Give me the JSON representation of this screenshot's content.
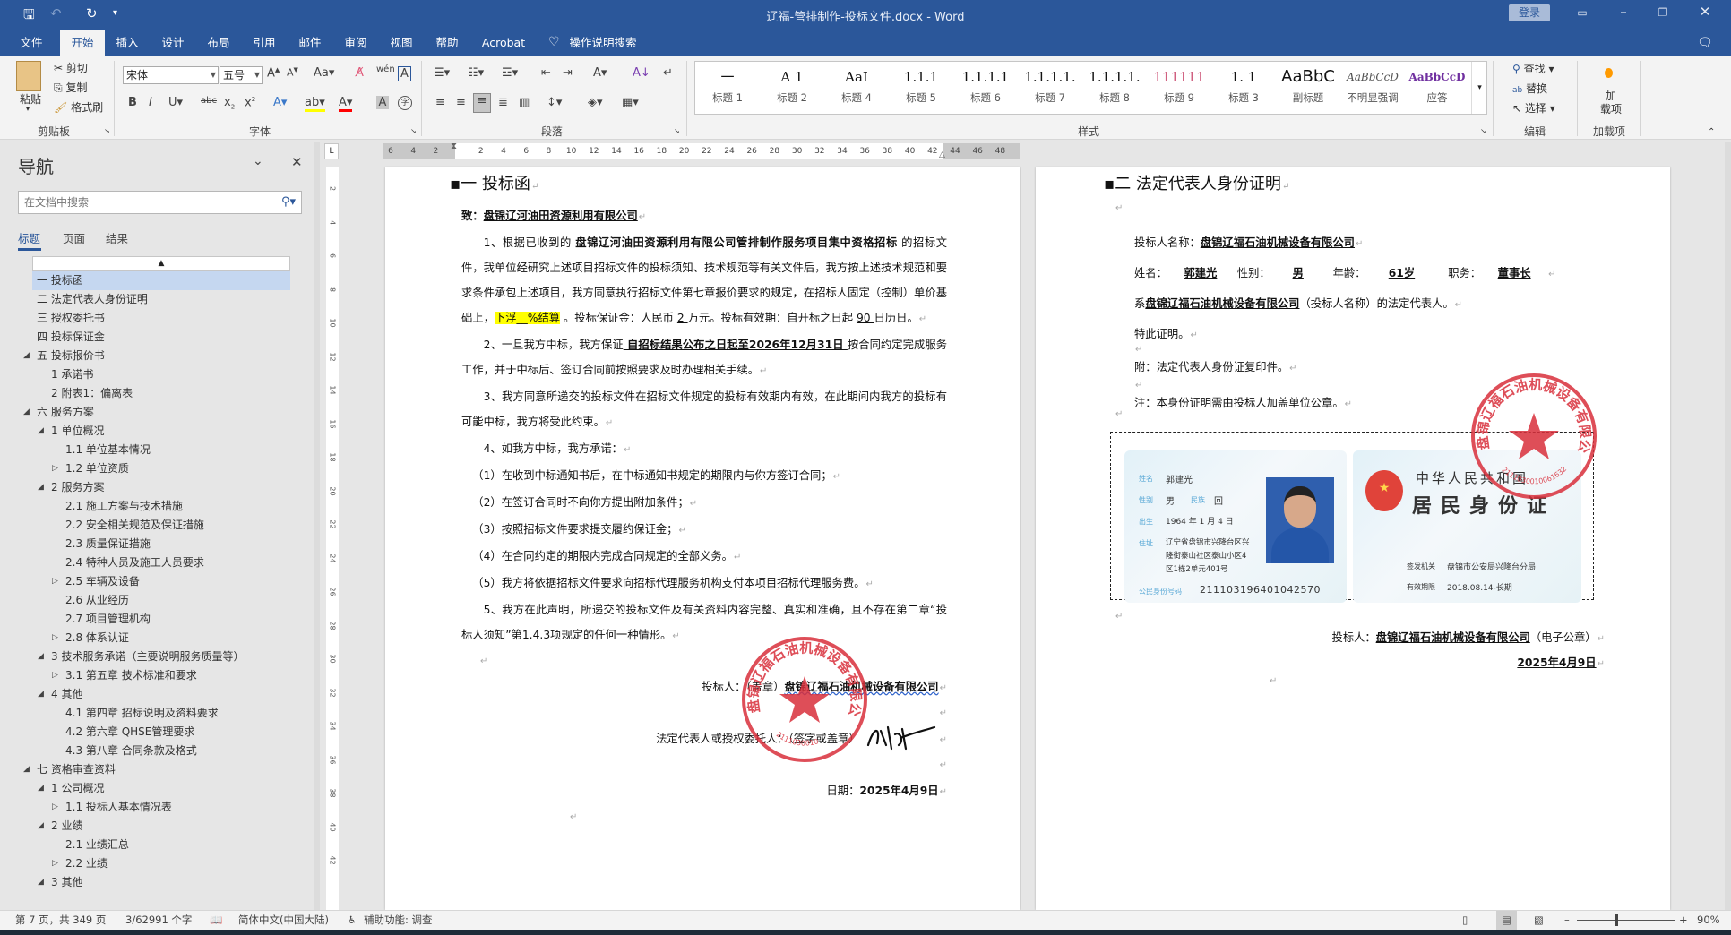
{
  "window": {
    "title": "辽福-管排制作-投标文件.docx  -  Word",
    "login": "登录"
  },
  "tabs": [
    "文件",
    "开始",
    "插入",
    "设计",
    "布局",
    "引用",
    "邮件",
    "审阅",
    "视图",
    "帮助",
    "Acrobat",
    "操作说明搜索"
  ],
  "ribbon": {
    "clipboard": {
      "label": "剪贴板",
      "paste": "粘贴",
      "cut": "剪切",
      "copy": "复制",
      "format_painter": "格式刷"
    },
    "font": {
      "label": "字体",
      "font_name": "宋体",
      "font_size": "五号"
    },
    "paragraph": {
      "label": "段落"
    },
    "styles": {
      "label": "样式",
      "items": [
        {
          "preview": "一",
          "name": "标题 1"
        },
        {
          "preview": "A 1",
          "name": "标题 2"
        },
        {
          "preview": "AaI",
          "name": "标题 4"
        },
        {
          "preview": "1.1.1",
          "name": "标题 5"
        },
        {
          "preview": "1.1.1.1",
          "name": "标题 6"
        },
        {
          "preview": "1.1.1.1.",
          "name": "标题 7"
        },
        {
          "preview": "1.1.1.1.",
          "name": "标题 8"
        },
        {
          "preview": "1.1.1.1.",
          "name": "标题 8"
        },
        {
          "preview": "111111",
          "name": "标题 9"
        },
        {
          "preview": "1. 1",
          "name": "标题 3"
        },
        {
          "preview": "AaBbC",
          "name": "副标题"
        },
        {
          "preview": "AaBbCcD",
          "name": "不明显强调"
        },
        {
          "preview": "AaBbCcD",
          "name": "应答"
        }
      ]
    },
    "editing": {
      "label": "编辑",
      "find": "查找",
      "replace": "替换",
      "select": "选择"
    },
    "addins": {
      "label": "加载项",
      "button": "加\n载项"
    }
  },
  "nav": {
    "title": "导航",
    "search_placeholder": "在文档中搜索",
    "tabs": [
      "标题",
      "页面",
      "结果"
    ],
    "items": [
      {
        "label": "一 投标函",
        "level": 0,
        "toggle": "",
        "selected": true
      },
      {
        "label": "二 法定代表人身份证明",
        "level": 0,
        "toggle": ""
      },
      {
        "label": "三 授权委托书",
        "level": 0,
        "toggle": ""
      },
      {
        "label": "四 投标保证金",
        "level": 0,
        "toggle": ""
      },
      {
        "label": "五 投标报价书",
        "level": 0,
        "toggle": "expanded"
      },
      {
        "label": "1 承诺书",
        "level": 1,
        "toggle": ""
      },
      {
        "label": "2 附表1：偏离表",
        "level": 1,
        "toggle": ""
      },
      {
        "label": "六 服务方案",
        "level": 0,
        "toggle": "expanded"
      },
      {
        "label": "1 单位概况",
        "level": 1,
        "toggle": "expanded"
      },
      {
        "label": "1.1 单位基本情况",
        "level": 2,
        "toggle": ""
      },
      {
        "label": "1.2 单位资质",
        "level": 2,
        "toggle": "collapsed"
      },
      {
        "label": "2 服务方案",
        "level": 1,
        "toggle": "expanded"
      },
      {
        "label": "2.1 施工方案与技术措施",
        "level": 2,
        "toggle": ""
      },
      {
        "label": "2.2 安全相关规范及保证措施",
        "level": 2,
        "toggle": ""
      },
      {
        "label": "2.3 质量保证措施",
        "level": 2,
        "toggle": ""
      },
      {
        "label": "2.4 特种人员及施工人员要求",
        "level": 2,
        "toggle": ""
      },
      {
        "label": "2.5 车辆及设备",
        "level": 2,
        "toggle": "collapsed"
      },
      {
        "label": "2.6 从业经历",
        "level": 2,
        "toggle": ""
      },
      {
        "label": "2.7 项目管理机构",
        "level": 2,
        "toggle": ""
      },
      {
        "label": "2.8 体系认证",
        "level": 2,
        "toggle": "collapsed"
      },
      {
        "label": "3 技术服务承诺（主要说明服务质量等）",
        "level": 1,
        "toggle": "expanded"
      },
      {
        "label": "3.1 第五章 技术标准和要求",
        "level": 2,
        "toggle": "collapsed"
      },
      {
        "label": "4 其他",
        "level": 1,
        "toggle": "expanded"
      },
      {
        "label": "4.1 第四章  招标说明及资料要求",
        "level": 2,
        "toggle": ""
      },
      {
        "label": "4.2 第六章  QHSE管理要求",
        "level": 2,
        "toggle": ""
      },
      {
        "label": "4.3 第八章  合同条款及格式",
        "level": 2,
        "toggle": ""
      },
      {
        "label": "七 资格审查资料",
        "level": 0,
        "toggle": "expanded"
      },
      {
        "label": "1 公司概况",
        "level": 1,
        "toggle": "expanded"
      },
      {
        "label": "1.1 投标人基本情况表",
        "level": 2,
        "toggle": "collapsed"
      },
      {
        "label": "2 业绩",
        "level": 1,
        "toggle": "expanded"
      },
      {
        "label": "2.1 业绩汇总",
        "level": 2,
        "toggle": ""
      },
      {
        "label": "2.2 业绩",
        "level": 2,
        "toggle": "collapsed"
      },
      {
        "label": "3 其他",
        "level": 1,
        "toggle": "expanded"
      }
    ]
  },
  "ruler": {
    "h": [
      "6",
      "4",
      "2",
      "",
      "2",
      "4",
      "6",
      "8",
      "10",
      "12",
      "14",
      "16",
      "18",
      "20",
      "22",
      "24",
      "26",
      "28",
      "30",
      "32",
      "34",
      "36",
      "38",
      "40",
      "42",
      "44",
      "46",
      "48"
    ],
    "v": [
      "2",
      "4",
      "6",
      "8",
      "10",
      "12",
      "14",
      "16",
      "18",
      "20",
      "22",
      "24",
      "26",
      "28",
      "30",
      "32",
      "34",
      "36",
      "38",
      "40",
      "42"
    ]
  },
  "page1": {
    "heading": "一 投标函",
    "to_label": "致：",
    "to_name": "盘锦辽河油田资源利用有限公司",
    "p1a": "1、根据已收到的 ",
    "p1_project": "盘锦辽河油田资源利用有限公司管排制作服务项目集中资格招标",
    "p1b": " 的招标文件，我单位经研究上述项目招标文件的投标须知、技术规范等有关文件后，我方按上述技术规范和要求条件承包上述项目，我方同意执行招标文件第七章报价要求的规定，在招标人固定（控制）单价基础上，",
    "p1_float": "下浮__%结算",
    "p1c": " 。投标保证金：人民币 ",
    "p1_amount": "  2  ",
    "p1d": "万元。投标有效期：自开标之日起 ",
    "p1_days": " 90 ",
    "p1e": " 日历日。",
    "p2a": "2、一旦我方中标，我方保证",
    "p2_period": " 自招标结果公布之日起至2026年12月31日  ",
    "p2b": " 按合同约定完成服务工作，并于中标后、签订合同前按照要求及时办理相关手续。",
    "p3": "3、我方同意所递交的投标文件在招标文件规定的投标有效期内有效，在此期间内我方的投标有可能中标，我方将受此约束。",
    "p4": "4、如我方中标，我方承诺：",
    "p4_items": [
      "（1）在收到中标通知书后，在中标通知书规定的期限内与你方签订合同；",
      "（2）在签订合同时不向你方提出附加条件；",
      "（3）按照招标文件要求提交履约保证金；",
      "（4）在合同约定的期限内完成合同规定的全部义务。",
      "（5）我方将依据招标文件要求向招标代理服务机构支付本项目招标代理服务费。"
    ],
    "p5": "5、我方在此声明，所递交的投标文件及有关资料内容完整、真实和准确，且不存在第二章“投标人须知”第1.4.3项规定的任何一种情形。",
    "bidder_label": "投标人：（盖章）",
    "bidder_name": "盘锦辽福石油机械设备有限公司",
    "rep_label": "法定代表人或授权委托人：（签字或盖章）",
    "date_label": "日期：",
    "date": "2025年4月9日",
    "seal_text": "盘锦辽福石油机械设备有限公司",
    "seal_number": "2111030010",
    "signature": "刘洋"
  },
  "page2": {
    "heading": "二 法定代表人身份证明",
    "name_label": "投标人名称：",
    "company": "盘锦辽福石油机械设备有限公司",
    "person_label": "姓名：",
    "person": "郭建光",
    "gender_label": "性别：",
    "gender": "男",
    "age_label": "年龄：",
    "age": "61岁",
    "title_label": "职务：",
    "title": "董事长",
    "is_prefix": "系",
    "is_suffix": "（投标人名称）的法定代表人。",
    "certify": "特此证明。",
    "attach": "附：法定代表人身份证复印件。",
    "note": "注：本身份证明需由投标人加盖单位公章。",
    "bidder_label": "投标人：",
    "bidder_suffix": "（电子公章）",
    "date": "2025年4月9日",
    "seal_number": "2111030010061632"
  },
  "idcard": {
    "name_label": "姓名",
    "name": "郭建光",
    "sex_label": "性别",
    "sex": "男",
    "ethnic_label": "民族",
    "ethnic": "回",
    "birth_label": "出生",
    "birth": "1964 年 1 月 4 日",
    "addr_label": "住址",
    "addr": [
      "辽宁省盘锦市兴隆台区兴",
      "隆街泰山社区泰山小区4",
      "区1栋2单元401号"
    ],
    "id_label": "公民身份号码",
    "id": "211103196401042570",
    "country": "中华人民共和国",
    "card_title": "居民身份证",
    "issuer_label": "签发机关",
    "issuer": "盘锦市公安局兴隆台分局",
    "valid_label": "有效期限",
    "valid": "2018.08.14-长期"
  },
  "status": {
    "page": "第 7 页，共 349 页",
    "words": "3/62991 个字",
    "language": "简体中文(中国大陆)",
    "accessibility": "辅助功能: 调查",
    "zoom": "90%"
  },
  "colors": {
    "accent": "#2b579a",
    "seal": "#d9303c",
    "highlight": "#ffff00"
  }
}
